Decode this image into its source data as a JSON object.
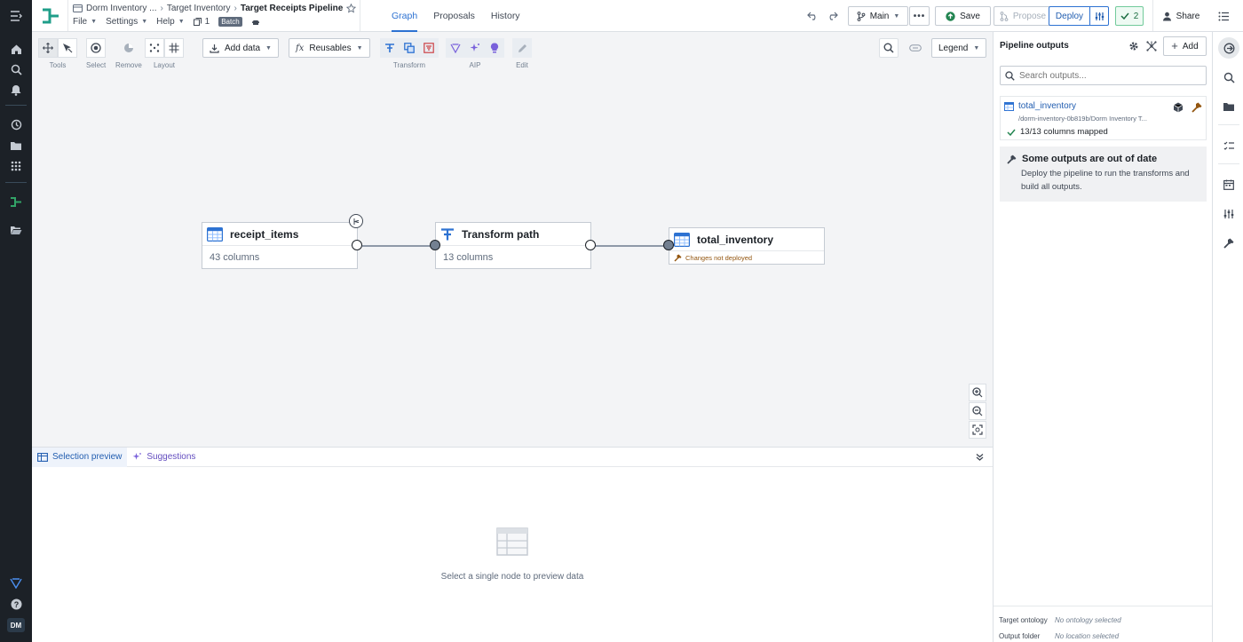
{
  "breadcrumb": {
    "items": [
      "Dorm Inventory ...",
      "Target Inventory",
      "Target Receipts Pipeline"
    ]
  },
  "menus": {
    "file": "File",
    "settings": "Settings",
    "help": "Help",
    "count": "1",
    "mode": "Batch"
  },
  "tabs": [
    "Graph",
    "Proposals",
    "History"
  ],
  "header": {
    "branch": "Main",
    "save": "Save",
    "propose": "Propose",
    "deploy": "Deploy",
    "checks": "2",
    "share": "Share"
  },
  "toolbar": {
    "tools": "Tools",
    "select": "Select",
    "remove": "Remove",
    "layout": "Layout",
    "add_data": "Add data",
    "reusables": "Reusables",
    "transform": "Transform",
    "aip": "AIP",
    "edit": "Edit",
    "legend": "Legend"
  },
  "nodes": {
    "n1": {
      "title": "receipt_items",
      "sub": "43 columns"
    },
    "n2": {
      "title": "Transform path",
      "sub": "13 columns"
    },
    "n3": {
      "title": "total_inventory",
      "warn": "Changes not deployed"
    }
  },
  "bottom": {
    "tab_preview": "Selection preview",
    "tab_suggestions": "Suggestions",
    "empty": "Select a single node to preview data"
  },
  "panel": {
    "title": "Pipeline outputs",
    "add": "Add",
    "search_placeholder": "Search outputs...",
    "output": {
      "name": "total_inventory",
      "path": "/dorm-inventory-0b819b/Dorm Inventory T...",
      "mapped": "13/13 columns mapped"
    },
    "warning": {
      "title": "Some outputs are out of date",
      "text": "Deploy the pipeline to run the transforms and build all outputs."
    },
    "footer": {
      "ontology_label": "Target ontology",
      "ontology_value": "No ontology selected",
      "folder_label": "Output folder",
      "folder_value": "No location selected"
    }
  },
  "user": {
    "initials": "DM"
  },
  "colors": {
    "accent": "#2d72d2",
    "brand_teal": "#32a467",
    "warning": "#935610",
    "rail": "#1c2127"
  }
}
